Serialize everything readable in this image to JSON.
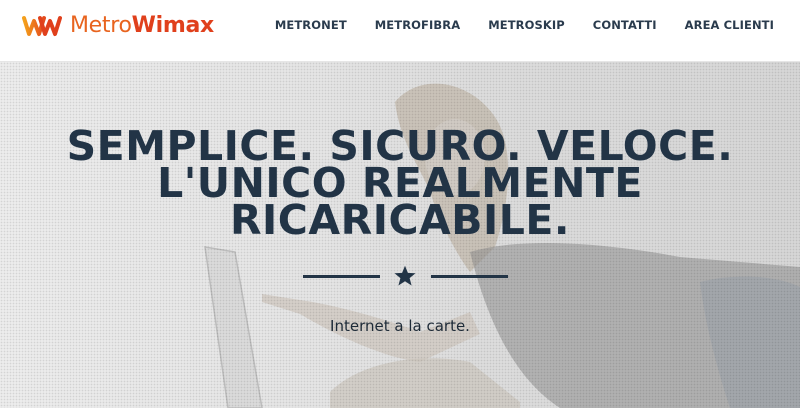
{
  "brand": {
    "logo_icon": "mw-logo-icon",
    "name_part1": "Metro",
    "name_part2": "Wimax",
    "colors": {
      "orange": "#e8641f",
      "red": "#e0401c"
    }
  },
  "nav": {
    "items": [
      {
        "label": "METRONET"
      },
      {
        "label": "METROFIBRA"
      },
      {
        "label": "METROSKIP"
      },
      {
        "label": "CONTATTI"
      },
      {
        "label": "AREA CLIENTI"
      }
    ]
  },
  "hero": {
    "headline_lines": [
      "SEMPLICE. SICURO. VELOCE.",
      "L'UNICO REALMENTE",
      "RICARICABILE."
    ],
    "divider_icon": "star-icon",
    "tagline": "Internet a la carte.",
    "text_color": "#223446"
  }
}
